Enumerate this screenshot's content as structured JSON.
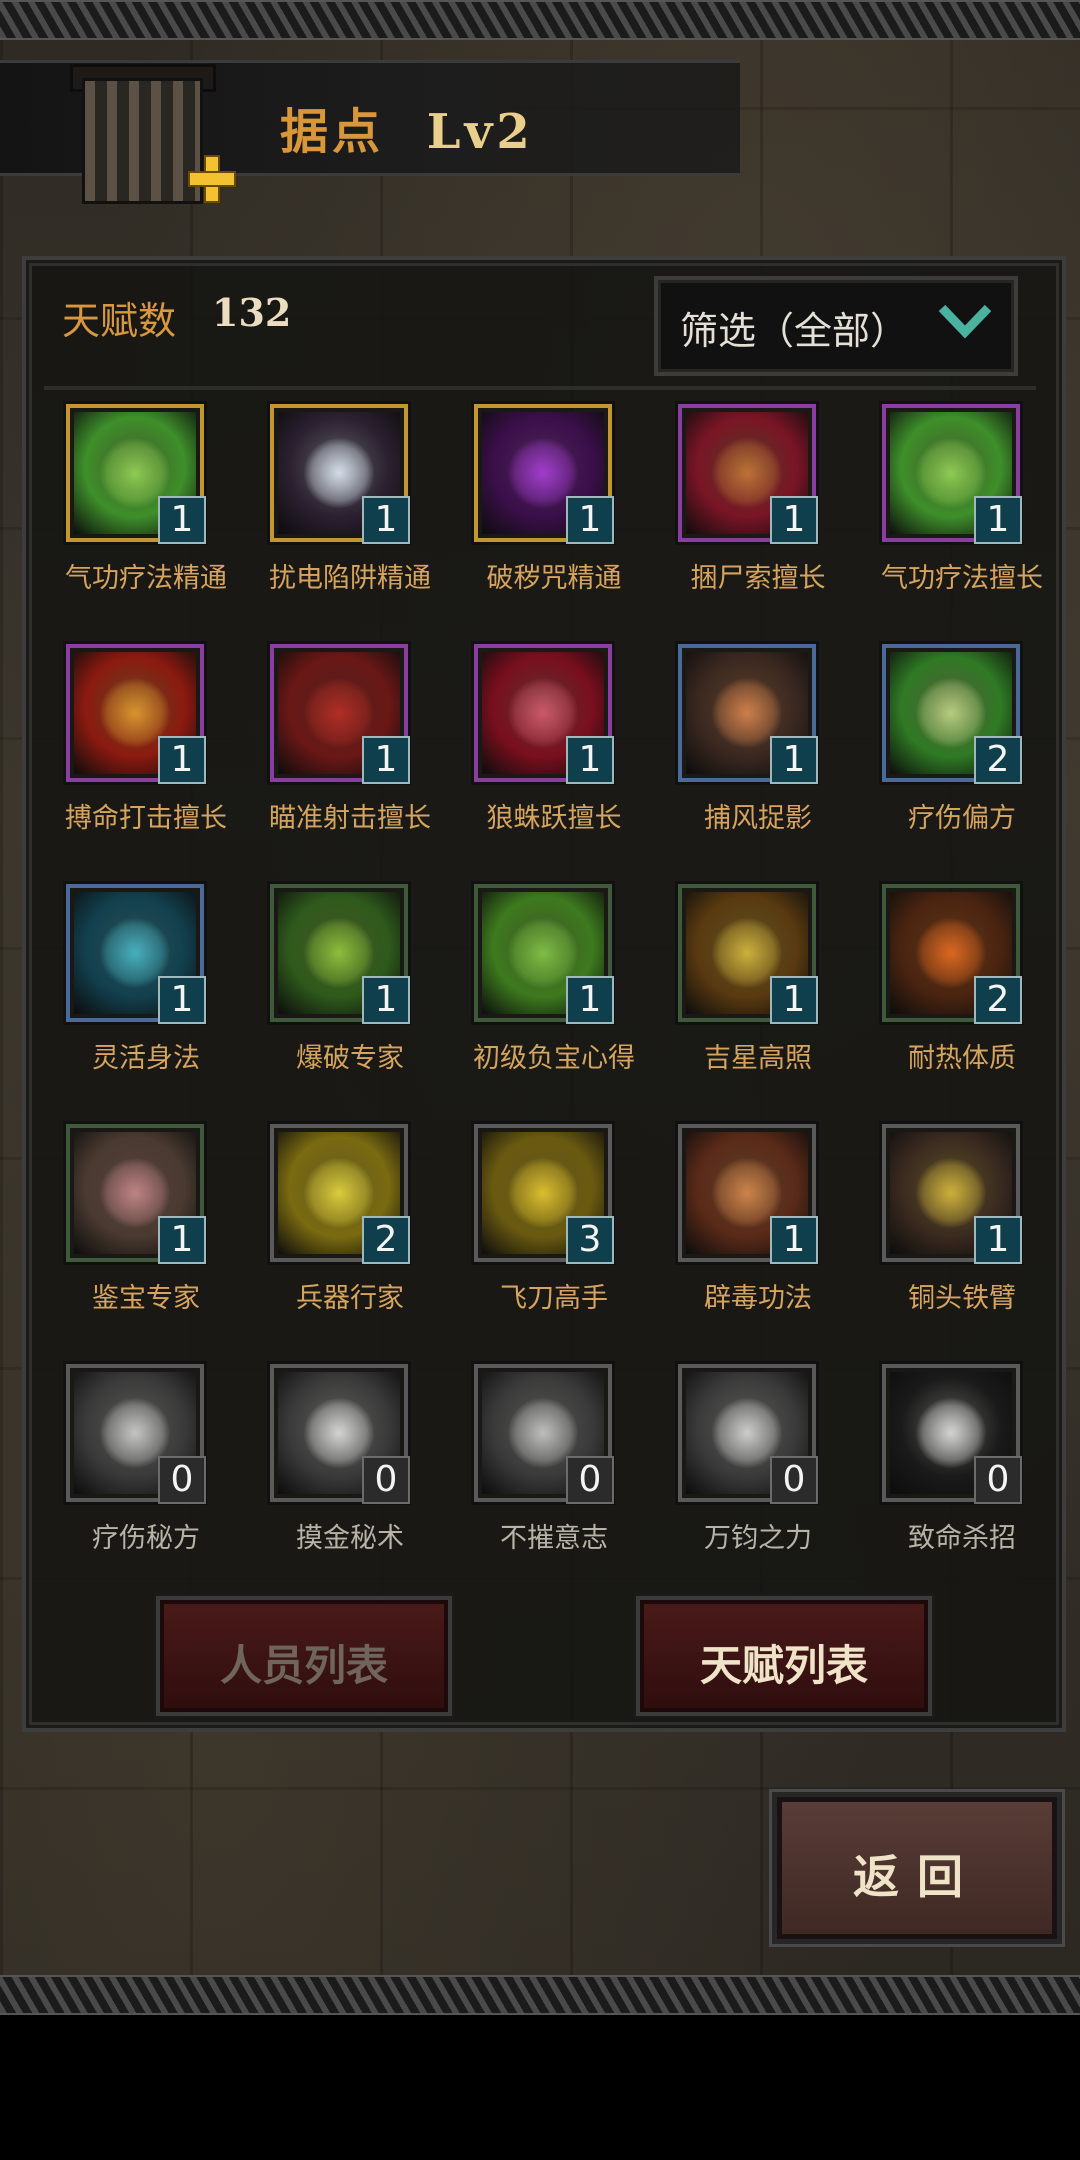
{
  "header": {
    "title": "据点",
    "level": "Lv2"
  },
  "stats": {
    "talent_count_label": "天赋数",
    "talent_count_value": "132"
  },
  "filter": {
    "label": "筛选（全部）",
    "icon": "chevron-down-icon"
  },
  "talents": [
    {
      "name": "气功疗法精通",
      "level": "1",
      "frame": "#c4962f",
      "art": "#3e8f2a",
      "glyph": "#9be05a"
    },
    {
      "name": "扰电陷阱精通",
      "level": "1",
      "frame": "#c4962f",
      "art": "#2b2030",
      "glyph": "#e8f2ff"
    },
    {
      "name": "破秽咒精通",
      "level": "1",
      "frame": "#c4962f",
      "art": "#3b0f4a",
      "glyph": "#b040e0"
    },
    {
      "name": "捆尸索擅长",
      "level": "1",
      "frame": "#8a3fa0",
      "art": "#7a1526",
      "glyph": "#d07a3a"
    },
    {
      "name": "气功疗法擅长",
      "level": "1",
      "frame": "#8a3fa0",
      "art": "#3e8f2a",
      "glyph": "#9be05a"
    },
    {
      "name": "搏命打击擅长",
      "level": "1",
      "frame": "#8a3fa0",
      "art": "#8c1a10",
      "glyph": "#f0a030"
    },
    {
      "name": "瞄准射击擅长",
      "level": "1",
      "frame": "#8a3fa0",
      "art": "#6a1816",
      "glyph": "#c23028"
    },
    {
      "name": "狼蛛跃擅长",
      "level": "1",
      "frame": "#8a3fa0",
      "art": "#7a0f1e",
      "glyph": "#e06070"
    },
    {
      "name": "捕风捉影",
      "level": "1",
      "frame": "#4a6a9a",
      "art": "#3a2820",
      "glyph": "#e08a50"
    },
    {
      "name": "疗伤偏方",
      "level": "2",
      "frame": "#4a6a9a",
      "art": "#2f7a24",
      "glyph": "#c7e08a"
    },
    {
      "name": "灵活身法",
      "level": "1",
      "frame": "#4a6a9a",
      "art": "#12404e",
      "glyph": "#4cc0d0"
    },
    {
      "name": "爆破专家",
      "level": "1",
      "frame": "#3e5a3a",
      "art": "#2f5a1c",
      "glyph": "#9ad040"
    },
    {
      "name": "初级负宝心得",
      "level": "1",
      "frame": "#3e5a3a",
      "art": "#3d7a1e",
      "glyph": "#8ad04a"
    },
    {
      "name": "吉星高照",
      "level": "1",
      "frame": "#3e5a3a",
      "art": "#5a3a10",
      "glyph": "#e0c040"
    },
    {
      "name": "耐热体质",
      "level": "2",
      "frame": "#3e5a3a",
      "art": "#4a2410",
      "glyph": "#f07020"
    },
    {
      "name": "鉴宝专家",
      "level": "1",
      "frame": "#3e5a3a",
      "art": "#4a3a30",
      "glyph": "#d09090"
    },
    {
      "name": "兵器行家",
      "level": "2",
      "frame": "#5a5a5a",
      "art": "#7a6a10",
      "glyph": "#f0e040"
    },
    {
      "name": "飞刀高手",
      "level": "3",
      "frame": "#5a5a5a",
      "art": "#6a5a10",
      "glyph": "#f0d030"
    },
    {
      "name": "辟毒功法",
      "level": "1",
      "frame": "#5a5a5a",
      "art": "#5a2a18",
      "glyph": "#e09050"
    },
    {
      "name": "铜头铁臂",
      "level": "1",
      "frame": "#5a5a5a",
      "art": "#3a2a20",
      "glyph": "#e0c040"
    },
    {
      "name": "疗伤秘方",
      "level": "0",
      "frame": "#5a5a5a",
      "art": "#3a3a3a",
      "glyph": "#d8d8d8"
    },
    {
      "name": "摸金秘术",
      "level": "0",
      "frame": "#5a5a5a",
      "art": "#3a3a3a",
      "glyph": "#e8e8e8"
    },
    {
      "name": "不摧意志",
      "level": "0",
      "frame": "#5a5a5a",
      "art": "#3a3a3a",
      "glyph": "#d0d0d0"
    },
    {
      "name": "万钧之力",
      "level": "0",
      "frame": "#5a5a5a",
      "art": "#3a3a3a",
      "glyph": "#e0e0e0"
    },
    {
      "name": "致命杀招",
      "level": "0",
      "frame": "#5a5a5a",
      "art": "#1a1a1a",
      "glyph": "#e8e8e8"
    }
  ],
  "tabs": {
    "members": "人员列表",
    "talents": "天赋列表"
  },
  "back_button": "返回"
}
